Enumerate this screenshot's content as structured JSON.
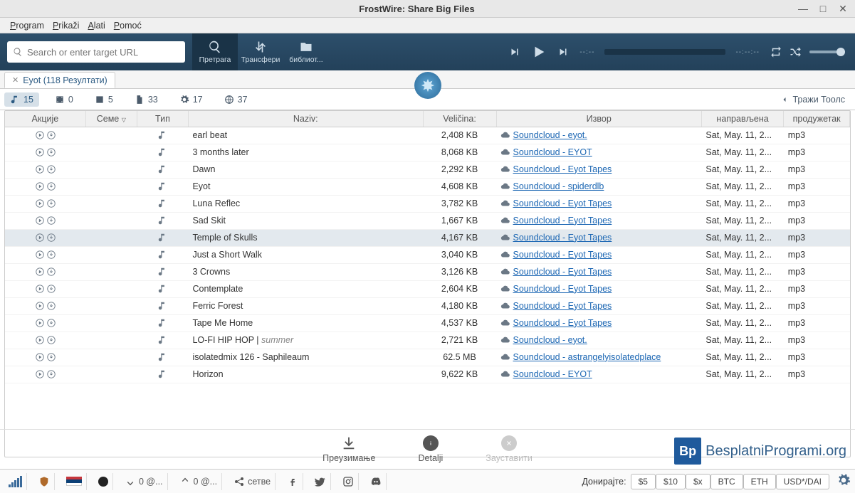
{
  "window": {
    "title": "FrostWire: Share Big Files"
  },
  "menu": {
    "program": "Program",
    "prikazi": "Prikaži",
    "alati": "Alati",
    "pomoc": "Pomoć"
  },
  "search": {
    "placeholder": "Search or enter target URL"
  },
  "toolbar": {
    "search": "Претрага",
    "transfers": "Трансфери",
    "library": "библиот..."
  },
  "player": {
    "time1": "--:--",
    "time2": "--:--:--"
  },
  "tab": {
    "label": "Eyot (118 Резултати)"
  },
  "filters": {
    "audio": "15",
    "video": "0",
    "image": "5",
    "doc": "33",
    "app": "17",
    "torrent": "37",
    "tools": "Тражи Тоолс"
  },
  "columns": {
    "actions": "Акције",
    "seed": "Семе",
    "type": "Тип",
    "name": "Naziv:",
    "size": "Veličina:",
    "source": "Извор",
    "created": "направљена",
    "ext": "продужетак"
  },
  "rows": [
    {
      "name": "earl beat",
      "suffix": "",
      "size": "2,408 KB",
      "source": "Soundcloud - eyot.",
      "created": "Sat, May. 11, 2...",
      "ext": "mp3"
    },
    {
      "name": "3 months later",
      "suffix": "",
      "size": "8,068 KB",
      "source": "Soundcloud - EYOT",
      "created": "Sat, May. 11, 2...",
      "ext": "mp3"
    },
    {
      "name": "Dawn",
      "suffix": "",
      "size": "2,292 KB",
      "source": "Soundcloud - Eyot Tapes",
      "created": "Sat, May. 11, 2...",
      "ext": "mp3"
    },
    {
      "name": "Eyot",
      "suffix": "",
      "size": "4,608 KB",
      "source": "Soundcloud - spiderdlb",
      "created": "Sat, May. 11, 2...",
      "ext": "mp3"
    },
    {
      "name": "Luna Reflec",
      "suffix": "",
      "size": "3,782 KB",
      "source": "Soundcloud - Eyot Tapes",
      "created": "Sat, May. 11, 2...",
      "ext": "mp3"
    },
    {
      "name": "Sad Skit",
      "suffix": "",
      "size": "1,667 KB",
      "source": "Soundcloud - Eyot Tapes",
      "created": "Sat, May. 11, 2...",
      "ext": "mp3"
    },
    {
      "name": "Temple of Skulls",
      "suffix": "",
      "size": "4,167 KB",
      "source": "Soundcloud - Eyot Tapes",
      "created": "Sat, May. 11, 2...",
      "ext": "mp3",
      "sel": true
    },
    {
      "name": "Just a Short Walk",
      "suffix": "",
      "size": "3,040 KB",
      "source": "Soundcloud - Eyot Tapes",
      "created": "Sat, May. 11, 2...",
      "ext": "mp3"
    },
    {
      "name": "3 Crowns",
      "suffix": "",
      "size": "3,126 KB",
      "source": "Soundcloud - Eyot Tapes",
      "created": "Sat, May. 11, 2...",
      "ext": "mp3"
    },
    {
      "name": "Contemplate",
      "suffix": "",
      "size": "2,604 KB",
      "source": "Soundcloud - Eyot Tapes",
      "created": "Sat, May. 11, 2...",
      "ext": "mp3"
    },
    {
      "name": "Ferric Forest",
      "suffix": "",
      "size": "4,180 KB",
      "source": "Soundcloud - Eyot Tapes",
      "created": "Sat, May. 11, 2...",
      "ext": "mp3"
    },
    {
      "name": "Tape Me Home",
      "suffix": "",
      "size": "4,537 KB",
      "source": "Soundcloud - Eyot Tapes",
      "created": "Sat, May. 11, 2...",
      "ext": "mp3"
    },
    {
      "name": "LO-FI HIP HOP | ",
      "suffix": "summer",
      "size": "2,721 KB",
      "source": "Soundcloud - eyot.",
      "created": "Sat, May. 11, 2...",
      "ext": "mp3"
    },
    {
      "name": "isolatedmix 126 - Saphileaum",
      "suffix": "",
      "size": "62.5 MB",
      "source": "Soundcloud - astrangelyisolatedplace",
      "created": "Sat, May. 11, 2...",
      "ext": "mp3"
    },
    {
      "name": "Horizon",
      "suffix": "",
      "size": "9,622 KB",
      "source": "Soundcloud - EYOT",
      "created": "Sat, May. 11, 2...",
      "ext": "mp3"
    }
  ],
  "bottom": {
    "download": "Преузимање",
    "details": "Detalji",
    "stop": "Зауставити"
  },
  "brand": {
    "text": "BesplatniProgrami.org",
    "logo": "Bp"
  },
  "status": {
    "down": "0 @...",
    "up": "0 @...",
    "seeds": "сетве",
    "donate_label": "Донирајте:",
    "donate": [
      "$5",
      "$10",
      "$x",
      "BTC",
      "ETH",
      "USD*/DAI"
    ]
  }
}
